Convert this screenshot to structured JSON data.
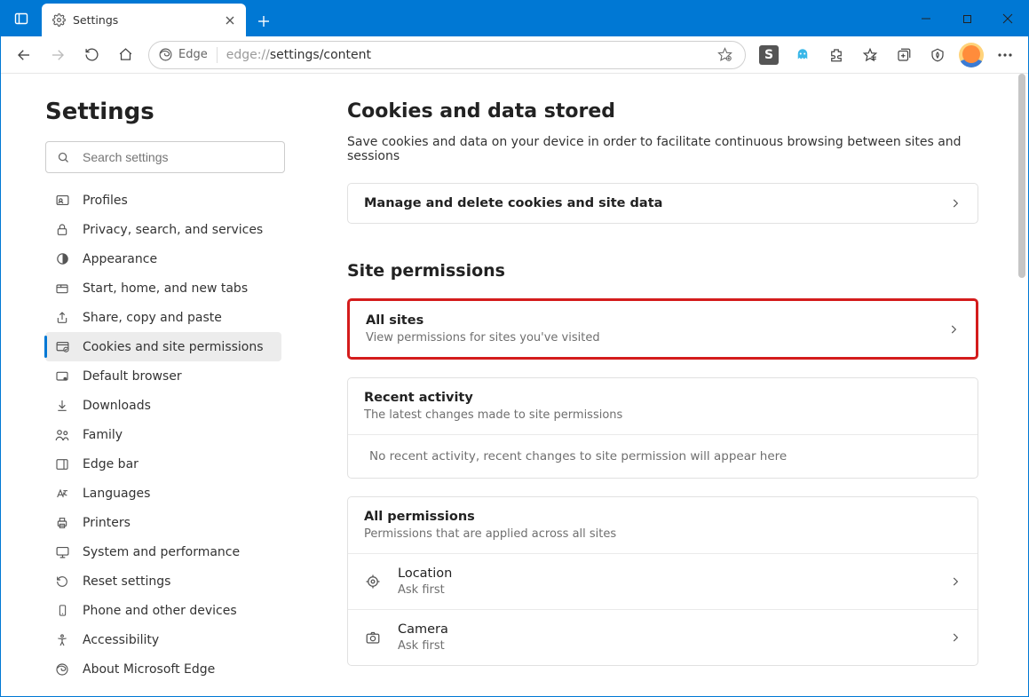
{
  "tab": {
    "title": "Settings"
  },
  "addressbar": {
    "browser_label": "Edge",
    "url_prefix": "edge://",
    "url_path": "settings/content"
  },
  "sidebar": {
    "title": "Settings",
    "search_placeholder": "Search settings",
    "items": [
      {
        "label": "Profiles"
      },
      {
        "label": "Privacy, search, and services"
      },
      {
        "label": "Appearance"
      },
      {
        "label": "Start, home, and new tabs"
      },
      {
        "label": "Share, copy and paste"
      },
      {
        "label": "Cookies and site permissions"
      },
      {
        "label": "Default browser"
      },
      {
        "label": "Downloads"
      },
      {
        "label": "Family"
      },
      {
        "label": "Edge bar"
      },
      {
        "label": "Languages"
      },
      {
        "label": "Printers"
      },
      {
        "label": "System and performance"
      },
      {
        "label": "Reset settings"
      },
      {
        "label": "Phone and other devices"
      },
      {
        "label": "Accessibility"
      },
      {
        "label": "About Microsoft Edge"
      }
    ]
  },
  "main": {
    "section1_title": "Cookies and data stored",
    "section1_desc": "Save cookies and data on your device in order to facilitate continuous browsing between sites and sessions",
    "manage_row": "Manage and delete cookies and site data",
    "section2_title": "Site permissions",
    "allsites": {
      "title": "All sites",
      "sub": "View permissions for sites you've visited"
    },
    "recent": {
      "title": "Recent activity",
      "sub": "The latest changes made to site permissions",
      "empty": "No recent activity, recent changes to site permission will appear here"
    },
    "allperms": {
      "title": "All permissions",
      "sub": "Permissions that are applied across all sites"
    },
    "perm_location": {
      "title": "Location",
      "sub": "Ask first"
    },
    "perm_camera": {
      "title": "Camera",
      "sub": "Ask first"
    }
  },
  "toolbar_s": "S"
}
